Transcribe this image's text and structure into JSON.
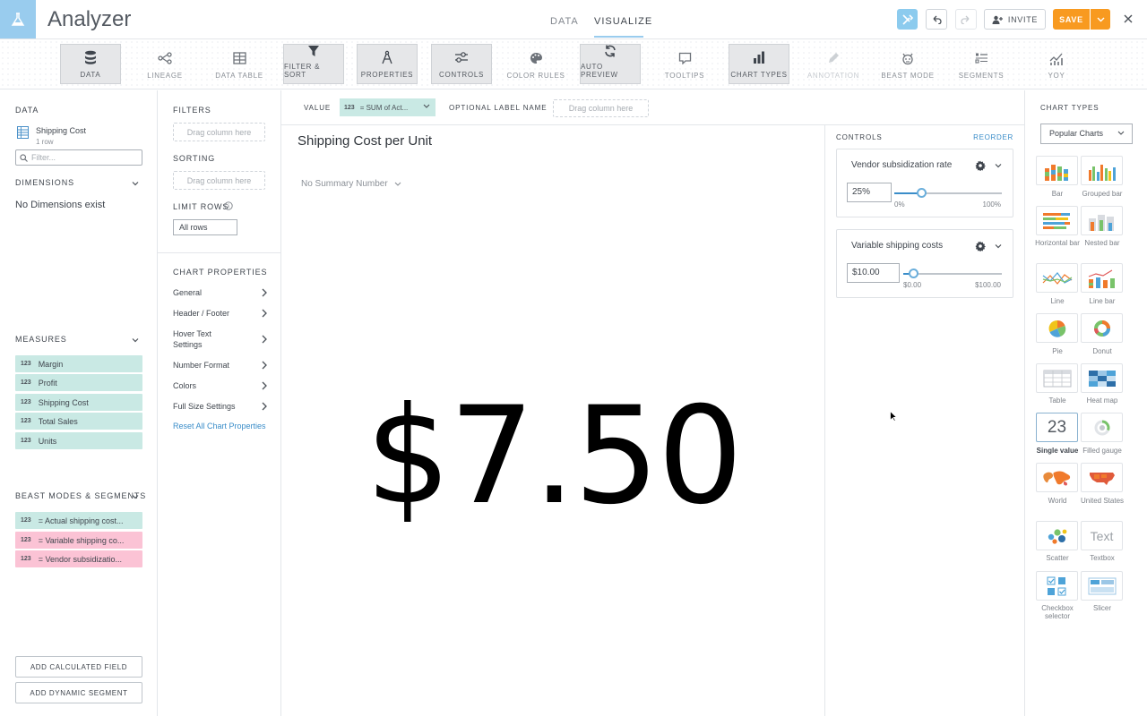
{
  "app": {
    "title": "Analyzer"
  },
  "header_tabs": [
    {
      "label": "DATA",
      "active": false
    },
    {
      "label": "VISUALIZE",
      "active": true
    }
  ],
  "header_actions": {
    "invite_label": "INVITE",
    "save_label": "SAVE"
  },
  "toolbar": [
    {
      "label": "DATA",
      "icon": "database-icon",
      "selected": true
    },
    {
      "label": "LINEAGE",
      "icon": "lineage-icon",
      "selected": false
    },
    {
      "label": "DATA TABLE",
      "icon": "table-icon",
      "selected": false
    },
    {
      "label": "FILTER & SORT",
      "icon": "filter-icon",
      "selected": true
    },
    {
      "label": "PROPERTIES",
      "icon": "compass-icon",
      "selected": true
    },
    {
      "label": "CONTROLS",
      "icon": "sliders-icon",
      "selected": true
    },
    {
      "label": "COLOR RULES",
      "icon": "palette-icon",
      "selected": false
    },
    {
      "label": "AUTO PREVIEW",
      "icon": "refresh-icon",
      "selected": true
    },
    {
      "label": "TOOLTIPS",
      "icon": "tooltip-icon",
      "selected": false
    },
    {
      "label": "CHART TYPES",
      "icon": "bar-chart-icon",
      "selected": true
    },
    {
      "label": "ANNOTATION",
      "icon": "pencil-icon",
      "selected": false,
      "disabled": true
    },
    {
      "label": "BEAST MODE",
      "icon": "beast-icon",
      "selected": false
    },
    {
      "label": "SEGMENTS",
      "icon": "segments-icon",
      "selected": false
    },
    {
      "label": "YOY",
      "icon": "yoy-icon",
      "selected": false
    }
  ],
  "data_panel": {
    "title": "DATA",
    "dataset": {
      "name": "Shipping Cost",
      "rows": "1 row"
    },
    "filter_placeholder": "Filter...",
    "dimensions_title": "DIMENSIONS",
    "no_dimensions": "No Dimensions exist",
    "measures_title": "MEASURES",
    "measure_type": "123",
    "measures": [
      "Margin",
      "Profit",
      "Shipping Cost",
      "Total Sales",
      "Units"
    ],
    "beast_title": "BEAST MODES & SEGMENTS",
    "beast_modes": [
      {
        "label": "= Actual shipping cost...",
        "color": "#c9e9e4"
      },
      {
        "label": "= Variable shipping co...",
        "color": "#fbc3d5"
      },
      {
        "label": "= Vendor subsidizatio...",
        "color": "#fbc3d5"
      }
    ],
    "add_calculated": "ADD CALCULATED FIELD",
    "add_segment": "ADD DYNAMIC SEGMENT"
  },
  "filter_panel": {
    "filters_title": "FILTERS",
    "drag_text": "Drag column here",
    "sorting_title": "SORTING",
    "limit_title": "LIMIT ROWS",
    "limit_value": "All rows",
    "chart_props_title": "CHART PROPERTIES",
    "props": [
      "General",
      "Header / Footer",
      "Hover Text Settings",
      "Number Format",
      "Colors",
      "Full Size Settings"
    ],
    "reset_label": "Reset All Chart Properties"
  },
  "shelf": {
    "value_label": "VALUE",
    "value_pill": "= SUM of Act...",
    "optional_label": "OPTIONAL LABEL NAME",
    "drag_text": "Drag column here"
  },
  "canvas": {
    "title": "Shipping Cost per Unit",
    "summary": "No Summary Number",
    "value": "$7.50"
  },
  "controls": {
    "title": "CONTROLS",
    "reorder": "REORDER",
    "items": [
      {
        "name": "Vendor subsidization rate",
        "value": "25%",
        "min_label": "0%",
        "max_label": "100%",
        "level": 0.25
      },
      {
        "name": "Variable shipping costs",
        "value": "$10.00",
        "min_label": "$0.00",
        "max_label": "$100.00",
        "level": 0.1
      }
    ]
  },
  "chart_types": {
    "title": "CHART TYPES",
    "dropdown": "Popular Charts",
    "selected": "Single value",
    "single_value_digits": "23",
    "textbox_glyph": "Text",
    "types": [
      {
        "label": "Bar",
        "icon": "bar-icon"
      },
      {
        "label": "Grouped bar",
        "icon": "grouped-bar-icon"
      },
      {
        "label": "Horizontal bar",
        "icon": "horizontal-bar-icon"
      },
      {
        "label": "Nested bar",
        "icon": "nested-bar-icon"
      },
      {
        "label": "Line",
        "icon": "line-icon"
      },
      {
        "label": "Line bar",
        "icon": "line-bar-icon"
      },
      {
        "label": "Pie",
        "icon": "pie-icon"
      },
      {
        "label": "Donut",
        "icon": "donut-icon"
      },
      {
        "label": "Table",
        "icon": "table-chart-icon"
      },
      {
        "label": "Heat map",
        "icon": "heat-map-icon"
      },
      {
        "label": "Single value",
        "icon": "single-value-icon"
      },
      {
        "label": "Filled gauge",
        "icon": "filled-gauge-icon"
      },
      {
        "label": "World",
        "icon": "world-map-icon"
      },
      {
        "label": "United States",
        "icon": "us-map-icon"
      },
      {
        "label": "Scatter",
        "icon": "scatter-icon"
      },
      {
        "label": "Textbox",
        "icon": "textbox-icon"
      },
      {
        "label": "Checkbox selector",
        "icon": "checkbox-icon"
      },
      {
        "label": "Slicer",
        "icon": "slicer-icon"
      }
    ]
  },
  "colors": {
    "accent": "#99ccee",
    "save": "#f89a20",
    "measure_pill": "#c9e9e4",
    "segment_pill": "#fbc3d5",
    "link": "#3a8dc9"
  }
}
